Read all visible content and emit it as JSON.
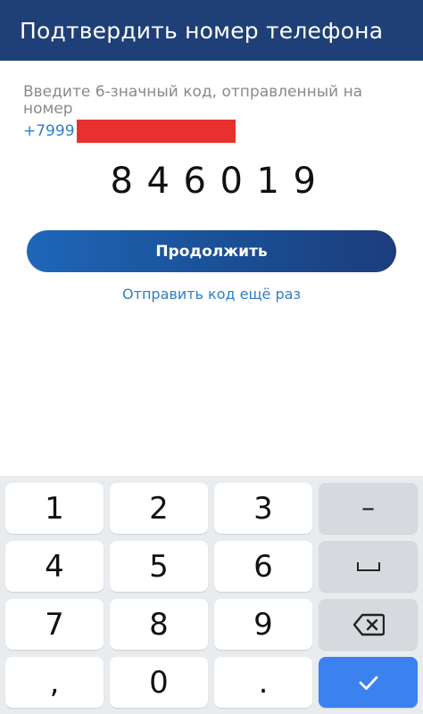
{
  "header": {
    "title": "Подтвердить номер телефона"
  },
  "form": {
    "instruction": "Введите 6-значный код, отправленный на номер",
    "phone_prefix": "+7999",
    "code_digits": [
      "8",
      "4",
      "6",
      "0",
      "1",
      "9"
    ],
    "continue_label": "Продолжить",
    "resend_label": "Отправить код ещё раз"
  },
  "keyboard": {
    "keys": [
      "1",
      "2",
      "3",
      "4",
      "5",
      "6",
      "7",
      "8",
      "9",
      ",",
      "0",
      "."
    ],
    "func_keys": {
      "dash": "–",
      "space": "space-icon",
      "backspace": "backspace-icon",
      "done": "check-icon"
    }
  },
  "colors": {
    "header": "#1f3f77",
    "accent": "#2f7ecb",
    "button": "#1a4f95",
    "redaction": "#e8312f",
    "done_key": "#3b82f0"
  }
}
